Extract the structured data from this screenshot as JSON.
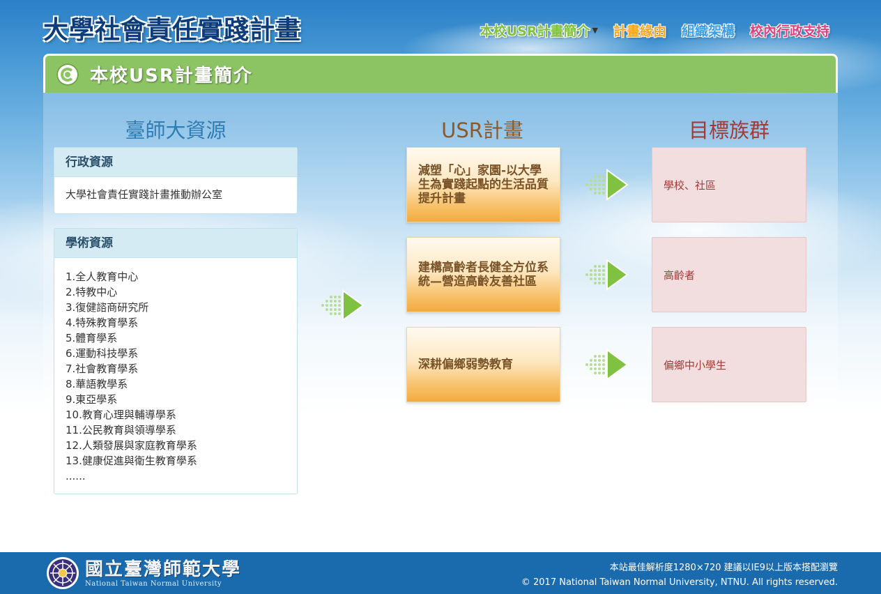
{
  "header": {
    "site_title": "大學社會責任實踐計畫",
    "nav": [
      {
        "label": "本校USR計畫簡介",
        "color": "#7fc241",
        "has_dropdown": true
      },
      {
        "label": "計畫緣由",
        "color": "#f5a623"
      },
      {
        "label": "組織架構",
        "color": "#3a9ee6"
      },
      {
        "label": "校內行政支持",
        "color": "#e0407e"
      }
    ]
  },
  "page": {
    "title": "本校USR計畫簡介",
    "accent_color": "#8cc464"
  },
  "columns": {
    "ntnu_resources": "臺師大資源",
    "usr_plans": "USR計畫",
    "target_groups": "目標族群"
  },
  "resources": {
    "admin": {
      "title": "行政資源",
      "text": "大學社會責任實踐計畫推動辦公室"
    },
    "academic": {
      "title": "學術資源",
      "items": [
        "1.全人教育中心",
        "2.特教中心",
        "3.復健諮商研究所",
        "4.特殊教育學系",
        "5.體育學系",
        "6.運動科技學系",
        "7.社會教育學系",
        "8.華語教學系",
        "9.東亞學系",
        "10.教育心理與輔導學系",
        "11.公民教育與領導學系",
        "12.人類發展與家庭教育學系",
        "13.健康促進與衛生教育學系",
        "......"
      ]
    }
  },
  "plans": [
    {
      "name": "減塑「心」家園-以大學生為實踐起點的生活品質提升計畫",
      "target": "學校、社區"
    },
    {
      "name": "建構高齡者長健全方位系統—營造高齡友善社區",
      "target": "高齡者"
    },
    {
      "name": "深耕偏鄉弱勢教育",
      "target": "偏鄉中小學生"
    }
  ],
  "footer": {
    "university_zh": "國立臺灣師範大學",
    "university_en": "National Taiwan Normal University",
    "resolution_note": "本站最佳解析度1280×720 建議以IE9以上版本搭配瀏覽",
    "copyright": "© 2017 National Taiwan Normal University, NTNU. All rights reserved."
  }
}
